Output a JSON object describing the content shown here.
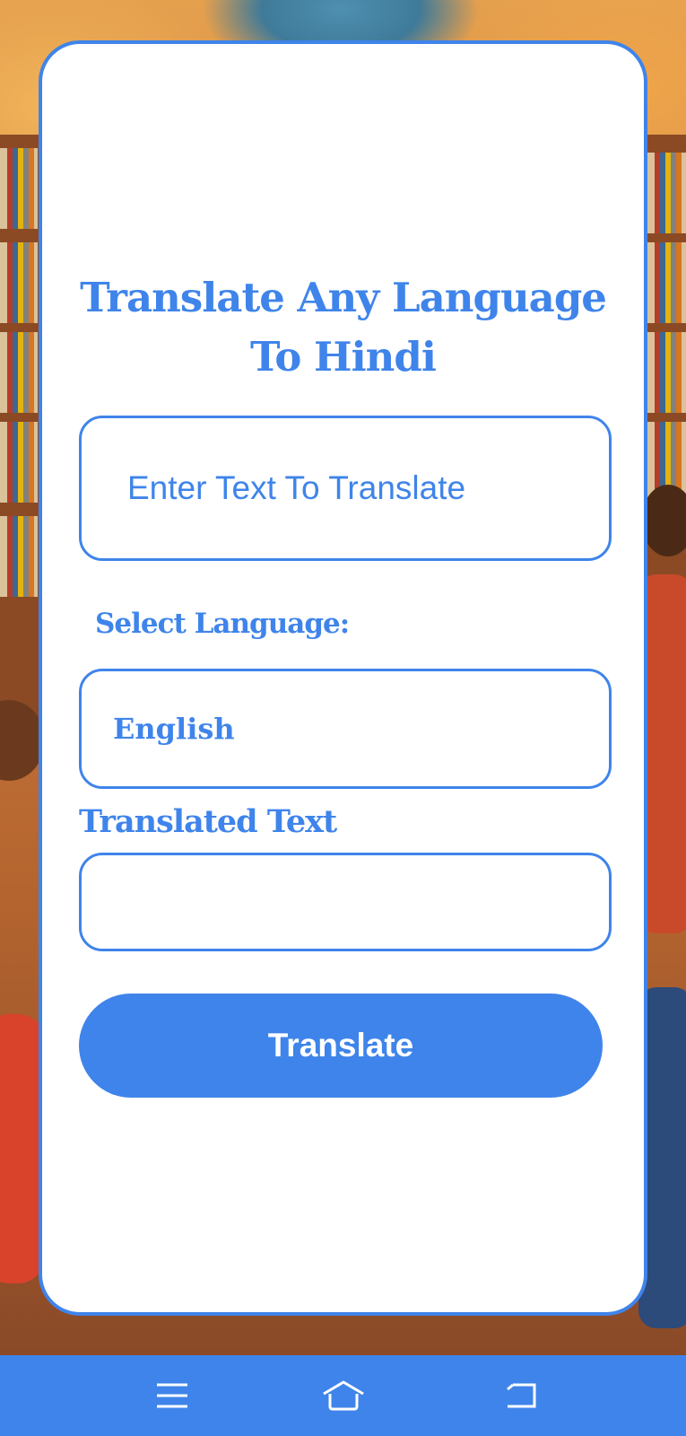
{
  "app": {
    "title_line1": "Translate Any Language",
    "title_line2": "To Hindi"
  },
  "input": {
    "placeholder": "Enter Text To Translate",
    "value": ""
  },
  "language": {
    "label": "Select Language:",
    "selected": "English"
  },
  "output": {
    "label": "Translated Text",
    "value": ""
  },
  "translate_button": {
    "label": "Translate"
  },
  "navbar": {
    "items": [
      {
        "icon": "menu-icon"
      },
      {
        "icon": "home-icon"
      },
      {
        "icon": "back-icon"
      }
    ]
  },
  "colors": {
    "accent": "#3f84ea",
    "card": "#ffffff",
    "navbar": "#3f84ea"
  }
}
